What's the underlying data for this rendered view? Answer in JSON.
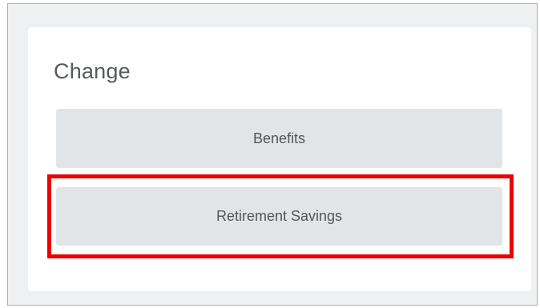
{
  "card": {
    "title": "Change",
    "buttons": {
      "benefits": "Benefits",
      "retirement_savings": "Retirement Savings"
    }
  },
  "colors": {
    "highlight": "#ee0000",
    "button_background": "#e2e5e8",
    "frame_border": "#9fb4cc"
  }
}
